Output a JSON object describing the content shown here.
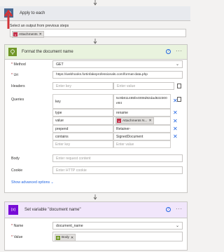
{
  "apply_each": {
    "title": "Apply to each",
    "select_label": "Select an output from previous steps",
    "token_label": "Attachments"
  },
  "format_action": {
    "title": "Format the document name",
    "method_label": "Method",
    "method_value": "GET",
    "uri_label": "Uri",
    "uri_value": "https://webhooks.fortinfakeprofessionals.com/format-data.php",
    "headers_label": "Headers",
    "enter_key": "Enter key",
    "enter_value": "Enter value",
    "queries_label": "Queries",
    "queries": [
      {
        "key": "key",
        "value": "5c9b811485fe4008d92dad632300e94"
      },
      {
        "key": "type",
        "value": "rename"
      },
      {
        "key": "value",
        "value": "",
        "token": "Attachments N..."
      },
      {
        "key": "prepend",
        "value": "Retainer-"
      },
      {
        "key": "contains",
        "value": "SignedDocument"
      }
    ],
    "body_label": "Body",
    "body_placeholder": "Enter request content",
    "cookie_label": "Cookie",
    "cookie_placeholder": "Enter HTTP cookie",
    "advanced_label": "Show advanced options"
  },
  "set_var": {
    "title": "Set variable \"document name\"",
    "name_label": "Name",
    "name_value": "document_name",
    "value_label": "Value",
    "value_token": "Body"
  },
  "colors": {
    "accent": "#2266e3",
    "http_green": "#709727",
    "variable_purple": "#770bd6",
    "loop_gray": "#486991",
    "highlight_red": "#d13438"
  }
}
